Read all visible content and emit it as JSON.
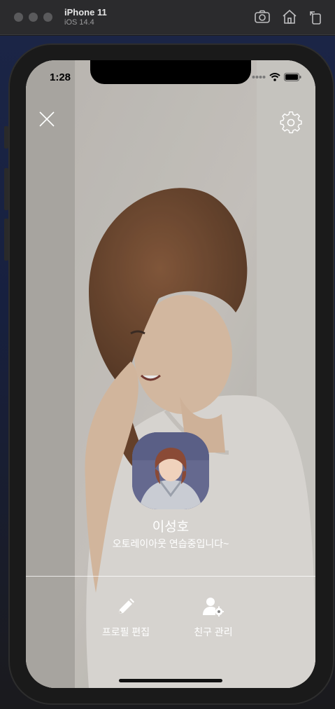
{
  "simulator": {
    "device_name": "iPhone 11",
    "os_version": "iOS 14.4",
    "toolbar_icons": [
      "screenshot-icon",
      "home-icon",
      "rotate-icon"
    ]
  },
  "status_bar": {
    "time": "1:28",
    "icons": [
      "cellular-dots-icon",
      "wifi-icon",
      "battery-icon"
    ]
  },
  "profile": {
    "name": "이성호",
    "status_message": "오토레이아웃 연습중입니다~"
  },
  "top_buttons": {
    "close_icon": "close-icon",
    "settings_icon": "gear-icon"
  },
  "actions": [
    {
      "label": "프로필 편집",
      "icon": "pencil-icon"
    },
    {
      "label": "친구 관리",
      "icon": "user-gear-icon"
    }
  ],
  "colors": {
    "text": "#ffffff",
    "simulator_bar": "#2b2b2d"
  }
}
